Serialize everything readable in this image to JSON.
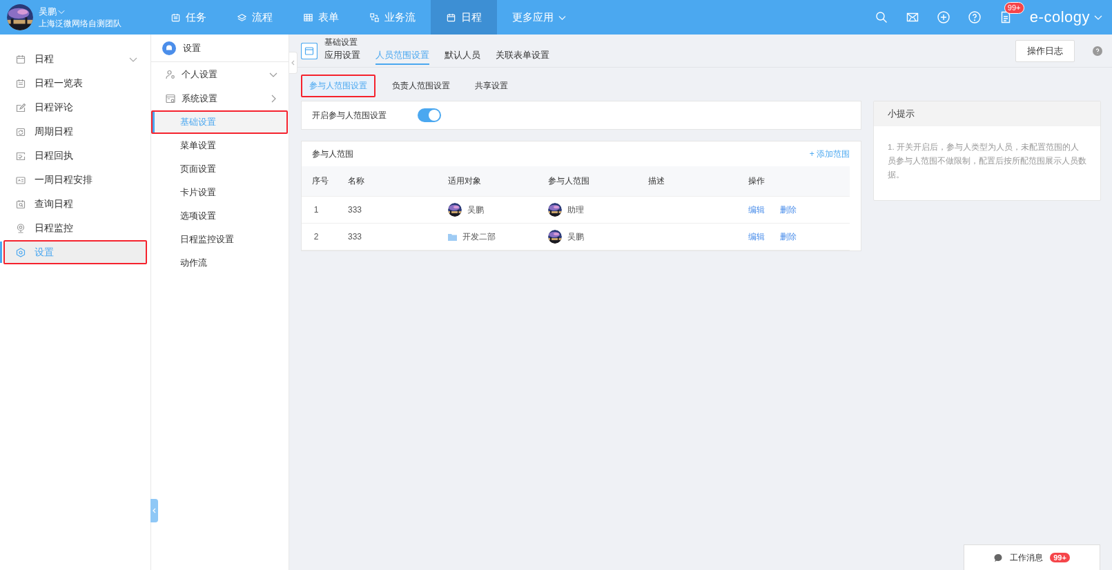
{
  "user": {
    "name": "吴鹏",
    "team": "上海泛微网络自测团队"
  },
  "nav": [
    {
      "label": "任务",
      "selected": false
    },
    {
      "label": "流程",
      "selected": false
    },
    {
      "label": "表单",
      "selected": false
    },
    {
      "label": "业务流",
      "selected": false
    },
    {
      "label": "日程",
      "selected": true
    },
    {
      "label": "更多应用",
      "selected": false
    }
  ],
  "notice_badge": "99+",
  "brand": "e-cology",
  "sidebar": [
    {
      "label": "日程",
      "selected": false,
      "highlighted": false,
      "expandable": true
    },
    {
      "label": "日程一览表",
      "selected": false,
      "highlighted": false
    },
    {
      "label": "日程评论",
      "selected": false,
      "highlighted": false
    },
    {
      "label": "周期日程",
      "selected": false,
      "highlighted": false
    },
    {
      "label": "日程回执",
      "selected": false,
      "highlighted": false
    },
    {
      "label": "一周日程安排",
      "selected": false,
      "highlighted": false
    },
    {
      "label": "查询日程",
      "selected": false,
      "highlighted": false
    },
    {
      "label": "日程监控",
      "selected": false,
      "highlighted": false
    },
    {
      "label": "设置",
      "selected": true,
      "highlighted": true
    }
  ],
  "settings_menu": {
    "title": "设置",
    "groups": [
      {
        "label": "个人设置",
        "expanded": true
      },
      {
        "label": "系统设置",
        "expanded": false,
        "children": [
          {
            "label": "基础设置",
            "selected": true,
            "highlighted": true
          },
          {
            "label": "菜单设置",
            "selected": false,
            "highlighted": false
          },
          {
            "label": "页面设置",
            "selected": false,
            "highlighted": false
          },
          {
            "label": "卡片设置",
            "selected": false,
            "highlighted": false
          },
          {
            "label": "选项设置",
            "selected": false,
            "highlighted": false
          },
          {
            "label": "日程监控设置",
            "selected": false,
            "highlighted": false
          },
          {
            "label": "动作流",
            "selected": false,
            "highlighted": false
          }
        ]
      }
    ]
  },
  "main": {
    "page_title": "基础设置",
    "tabs": [
      {
        "label": "应用设置",
        "selected": false
      },
      {
        "label": "人员范围设置",
        "selected": true
      },
      {
        "label": "默认人员",
        "selected": false
      },
      {
        "label": "关联表单设置",
        "selected": false
      }
    ],
    "log_button": "操作日志",
    "subtabs": [
      {
        "label": "参与人范围设置",
        "selected": true,
        "highlighted": true
      },
      {
        "label": "负责人范围设置",
        "selected": false,
        "highlighted": false
      },
      {
        "label": "共享设置",
        "selected": false,
        "highlighted": false
      }
    ],
    "switch": {
      "label": "开启参与人范围设置",
      "on": true
    },
    "scope_table": {
      "title": "参与人范围",
      "add_link": "+ 添加范围",
      "columns": [
        "序号",
        "名称",
        "适用对象",
        "参与人范围",
        "描述",
        "操作"
      ],
      "rows": [
        {
          "index": "1",
          "name": "333",
          "target": {
            "kind": "user",
            "label": "吴鹏"
          },
          "scope": {
            "kind": "user",
            "label": "助理"
          },
          "actions": [
            "编辑",
            "删除"
          ]
        },
        {
          "index": "2",
          "name": "333",
          "target": {
            "kind": "department",
            "label": "开发二部"
          },
          "scope": {
            "kind": "user",
            "label": "吴鹏"
          },
          "actions": [
            "编辑",
            "删除"
          ]
        }
      ]
    }
  },
  "tips": {
    "title": "小提示",
    "text": "1. 开关开启后，参与人类型为人员，未配置范围的人员参与人范围不做限制，配置后按所配范围展示人员数据。"
  },
  "message_dock": {
    "label": "工作消息",
    "badge": "99+"
  }
}
